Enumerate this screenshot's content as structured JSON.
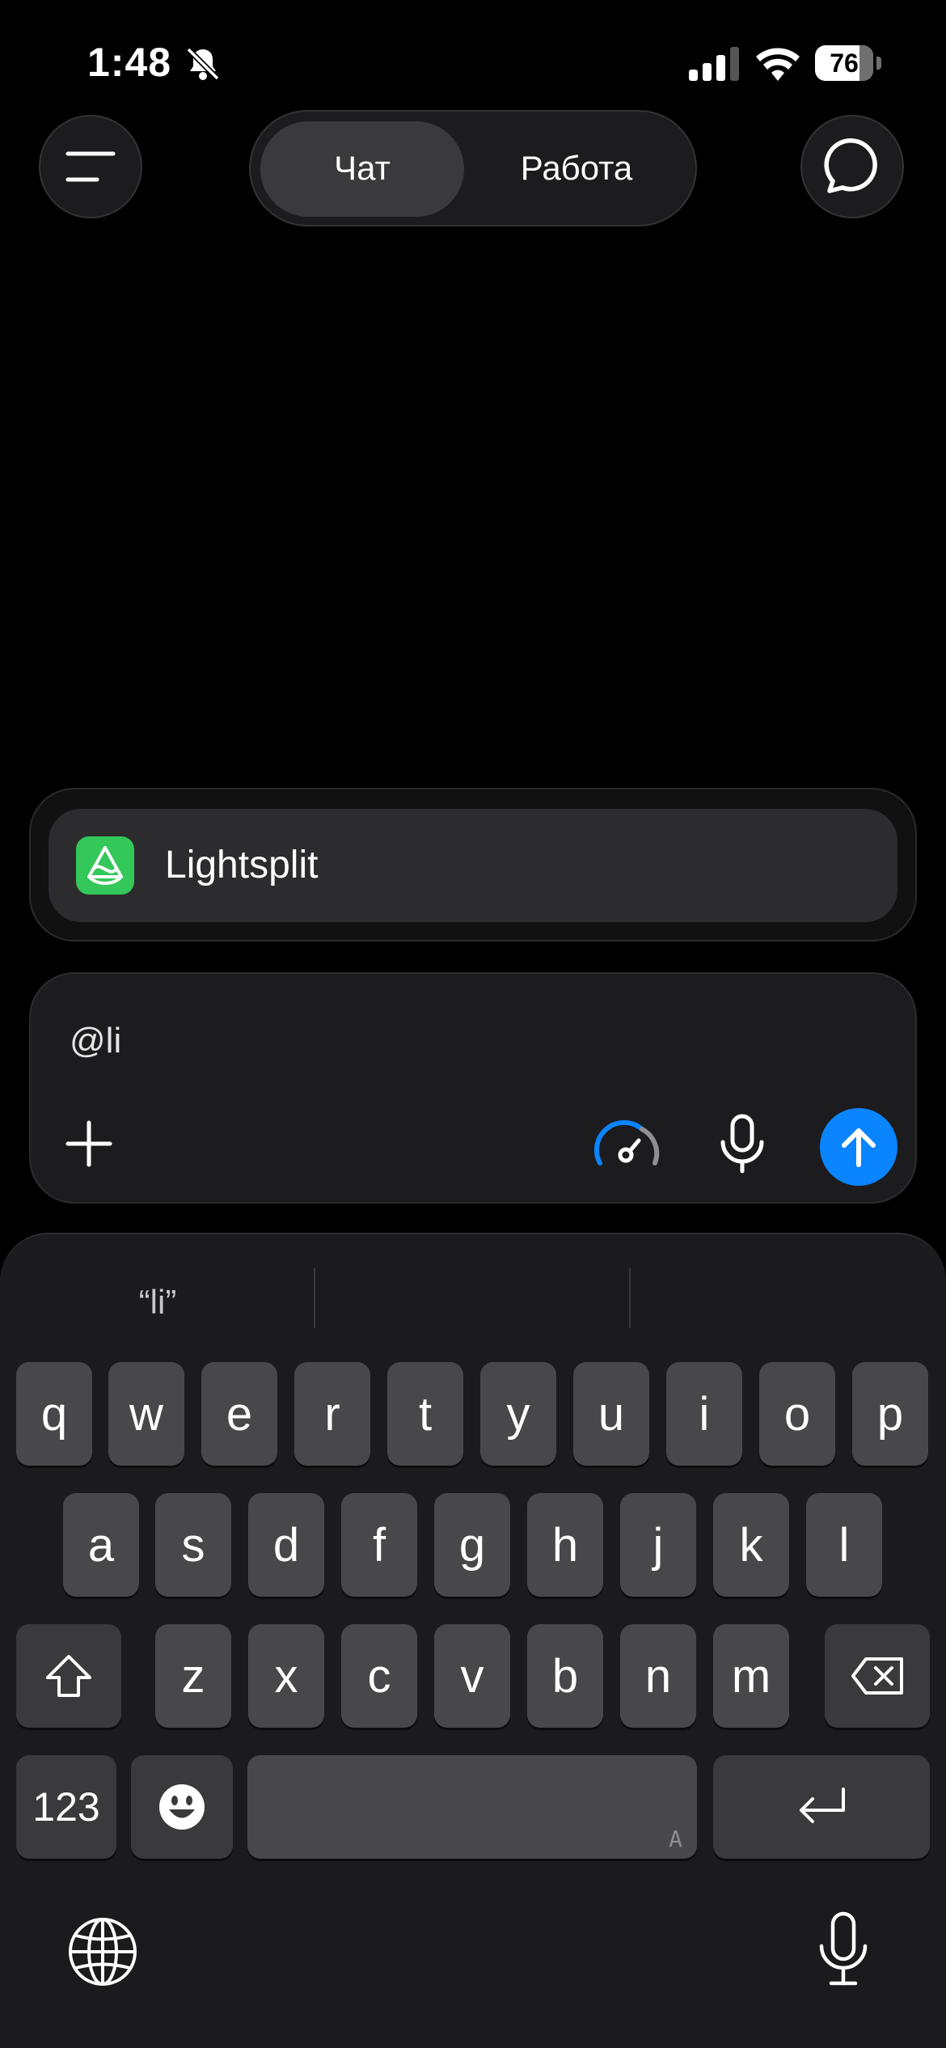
{
  "status_bar": {
    "time": "1:48",
    "battery_level": "76",
    "icons": [
      "bell-slash-icon",
      "cellular-signal-icon",
      "wifi-icon",
      "battery-icon"
    ]
  },
  "header": {
    "tabs": [
      {
        "label": "Чат",
        "active": true
      },
      {
        "label": "Работа",
        "active": false
      }
    ],
    "left_icon": "menu-icon",
    "right_icon": "new-chat-icon"
  },
  "mention": {
    "app_name": "Lightsplit",
    "icon_color": "#34c759"
  },
  "composer": {
    "text": "@li",
    "send_color": "#0a84ff",
    "icons": [
      "plus-icon",
      "speed-dial-icon",
      "microphone-icon",
      "send-arrow-icon"
    ]
  },
  "keyboard": {
    "predictions": [
      "“li”",
      "",
      ""
    ],
    "row1": [
      "q",
      "w",
      "e",
      "r",
      "t",
      "y",
      "u",
      "i",
      "o",
      "p"
    ],
    "row2": [
      "a",
      "s",
      "d",
      "f",
      "g",
      "h",
      "j",
      "k",
      "l"
    ],
    "row3": [
      "z",
      "x",
      "c",
      "v",
      "b",
      "n",
      "m"
    ],
    "numbers_label": "123",
    "space_hint": "A"
  }
}
